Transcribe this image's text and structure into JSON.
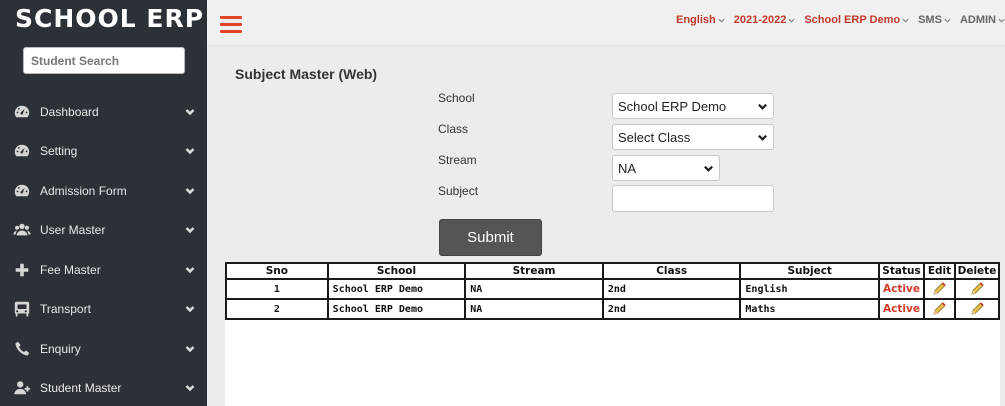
{
  "sidebar": {
    "logo": "SCHOOL ERP",
    "search_placeholder": "Student Search",
    "items": [
      {
        "label": "Dashboard",
        "icon": "dashboard-gauge-icon"
      },
      {
        "label": "Setting",
        "icon": "gauge-icon"
      },
      {
        "label": "Admission Form",
        "icon": "gauge-icon"
      },
      {
        "label": "User Master",
        "icon": "users-icon"
      },
      {
        "label": "Fee Master",
        "icon": "plus-icon"
      },
      {
        "label": "Transport",
        "icon": "bus-icon"
      },
      {
        "label": "Enquiry",
        "icon": "phone-icon"
      },
      {
        "label": "Student Master",
        "icon": "user-plus-icon"
      }
    ]
  },
  "topbar": {
    "menu_icon": "hamburger-icon",
    "accent_color": "#e0452a",
    "nav": [
      {
        "label": "English",
        "color": "#c0392b"
      },
      {
        "label": "2021-2022",
        "color": "#c0392b"
      },
      {
        "label": "School ERP Demo",
        "color": "#c0392b"
      },
      {
        "label": "SMS",
        "color": "#666666"
      },
      {
        "label": "ADMIN",
        "color": "#666666"
      }
    ]
  },
  "page": {
    "title": "Subject Master (Web)"
  },
  "form": {
    "school_label": "School",
    "school_value": "School ERP Demo",
    "class_label": "Class",
    "class_value": "Select Class",
    "stream_label": "Stream",
    "stream_value": "NA",
    "subject_label": "Subject",
    "subject_value": "",
    "submit_label": "Submit"
  },
  "table": {
    "headers": [
      "Sno",
      "School",
      "Stream",
      "Class",
      "Subject",
      "Status",
      "Edit",
      "Delete"
    ],
    "rows": [
      {
        "sno": "1",
        "school": "School ERP Demo",
        "stream": "NA",
        "class": "2nd",
        "subject": "English",
        "status": "Active"
      },
      {
        "sno": "2",
        "school": "School ERP Demo",
        "stream": "NA",
        "class": "2nd",
        "subject": "Maths",
        "status": "Active"
      }
    ],
    "status_color": "#d23a2a"
  }
}
